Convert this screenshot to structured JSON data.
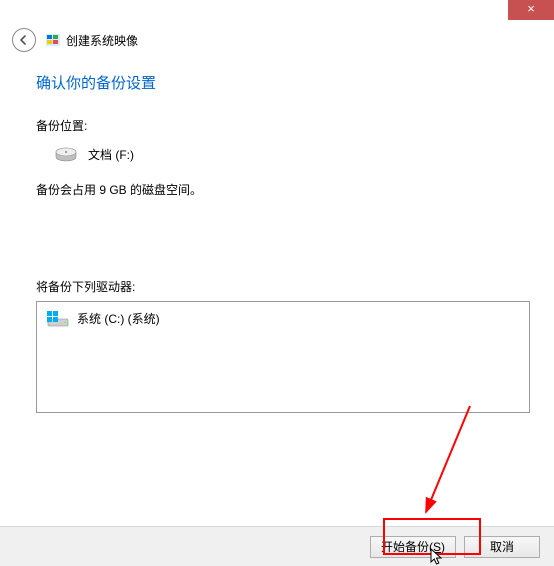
{
  "titlebar": {
    "close_glyph": "×"
  },
  "header": {
    "window_title": "创建系统映像"
  },
  "main": {
    "heading": "确认你的备份设置",
    "backup_location_label": "备份位置:",
    "backup_destination": "文档 (F:)",
    "size_estimate": "备份会占用 9 GB 的磁盘空间。",
    "drives_label": "将备份下列驱动器:",
    "drives": [
      {
        "name": "系统 (C:) (系统)"
      }
    ]
  },
  "footer": {
    "start_button_prefix": "开始备份(",
    "start_button_hotkey": "S",
    "start_button_suffix": ")",
    "cancel_button": "取消"
  }
}
